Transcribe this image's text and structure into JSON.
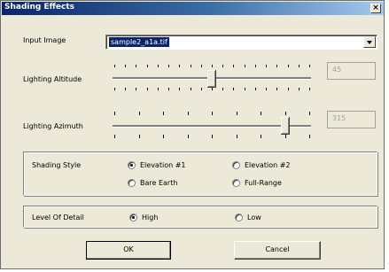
{
  "window": {
    "title": "Shading Effects",
    "close_glyph": "×",
    "close_icon": "close-icon"
  },
  "input_image": {
    "label": "Input Image",
    "value": "sample2_a1a.tif",
    "arrow_icon": "chevron-down-icon"
  },
  "altitude": {
    "label": "Lighting Altitude",
    "value": "45",
    "level": 45,
    "max": 90
  },
  "azimuth": {
    "label": "Lighting Azimuth",
    "value": "315",
    "level": 315,
    "max": 360
  },
  "shading_style": {
    "label": "Shading Style",
    "options": [
      "Elevation #1",
      "Elevation #2",
      "Bare Earth",
      "Full-Range"
    ],
    "selected": "Elevation #1"
  },
  "level_of_detail": {
    "label": "Level Of Detail",
    "options": [
      "High",
      "Low"
    ],
    "selected": "High"
  },
  "buttons": {
    "ok": "OK",
    "cancel": "Cancel"
  }
}
